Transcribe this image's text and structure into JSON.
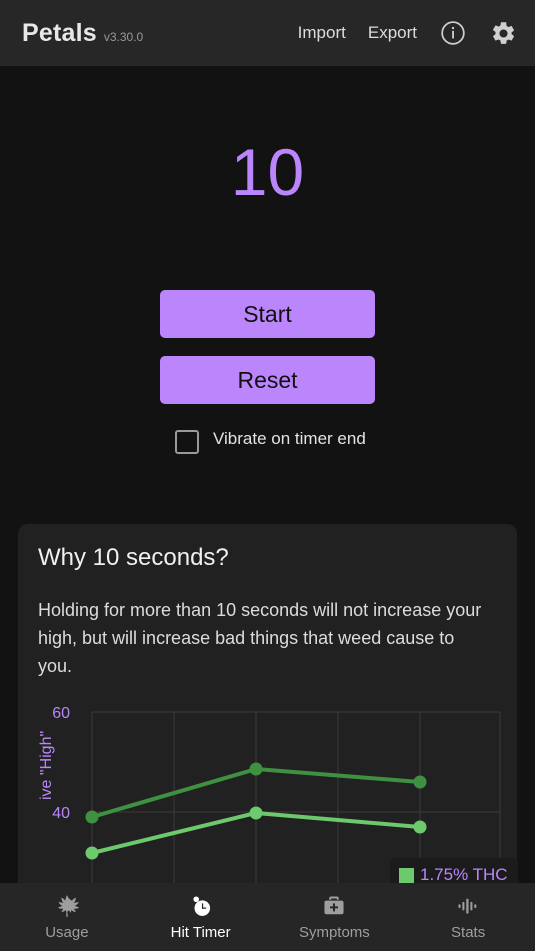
{
  "header": {
    "brand": "Petals",
    "version": "v3.30.0",
    "import_label": "Import",
    "export_label": "Export",
    "info_icon": "info-circle-icon",
    "settings_icon": "gear-icon"
  },
  "timer": {
    "value": "10",
    "start_label": "Start",
    "reset_label": "Reset",
    "vibrate_label": "Vibrate on timer end",
    "vibrate_checked": false
  },
  "card": {
    "title": "Why 10 seconds?",
    "body": "Holding for more than 10 seconds will not increase your high, but will increase bad things that weed cause to you."
  },
  "chart_data": {
    "type": "line",
    "title": "",
    "xlabel": "",
    "ylabel": "ive \"High\"",
    "ylim": [
      20,
      62
    ],
    "yticks": [
      60,
      40
    ],
    "ytick_labels": [
      "60",
      "40"
    ],
    "grid": true,
    "legend_position": "bottom-right",
    "x": [
      0,
      1,
      2,
      3,
      4,
      5
    ],
    "series": [
      {
        "name": "series-upper",
        "color": "#3f9142",
        "values": [
          39,
          null,
          null,
          48,
          null,
          45
        ]
      },
      {
        "name": "series-lower",
        "color": "#6cc96c",
        "values": [
          31,
          null,
          null,
          40,
          null,
          36
        ]
      }
    ],
    "legend": [
      {
        "label": "1.75% THC",
        "color": "#6cc96c"
      }
    ]
  },
  "colors": {
    "accent_purple": "#bb86fc",
    "page_background": "#121212",
    "card_background": "#212121",
    "appbar_background": "#272727",
    "series_dark_green": "#3f9142",
    "series_light_green": "#6cc96c"
  },
  "bottomnav": {
    "items": [
      {
        "label": "Usage",
        "icon": "cannabis-leaf-icon",
        "active": false
      },
      {
        "label": "Hit Timer",
        "icon": "stopwatch-icon",
        "active": true
      },
      {
        "label": "Symptoms",
        "icon": "medical-bag-icon",
        "active": false
      },
      {
        "label": "Stats",
        "icon": "waveform-icon",
        "active": false
      }
    ]
  }
}
